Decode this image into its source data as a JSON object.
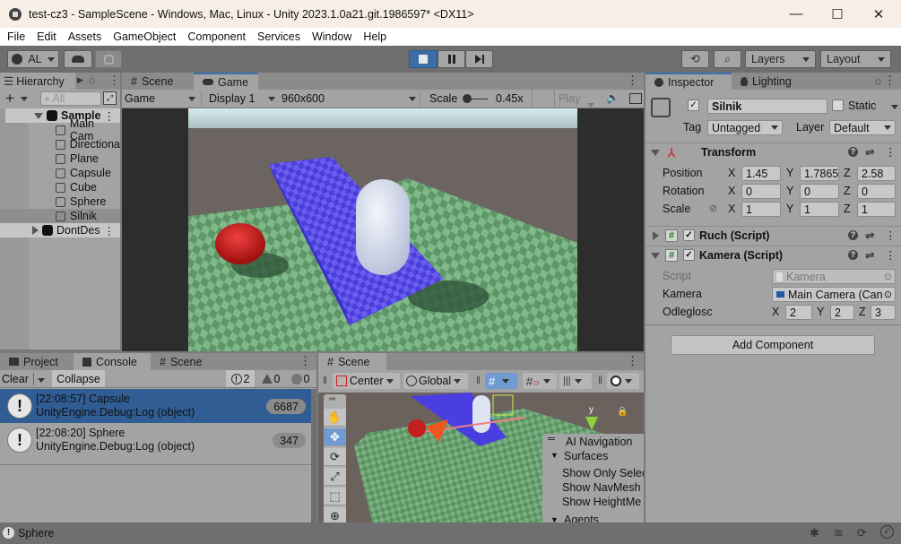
{
  "window": {
    "title": "test-cz3 - SampleScene - Windows, Mac, Linux - Unity 2023.1.0a21.git.1986597* <DX11>",
    "controls": {
      "minimize": "—",
      "maximize": "☐",
      "close": "✕"
    }
  },
  "menu": [
    "File",
    "Edit",
    "Assets",
    "GameObject",
    "Component",
    "Services",
    "Window",
    "Help"
  ],
  "toolbar": {
    "account": "AL",
    "cloud_icon": "cloud-icon",
    "collab_icon": "plastic-icon",
    "play_state": "playing",
    "accent": "#3a6ea5",
    "layers": "Layers",
    "layout": "Layout"
  },
  "hierarchy": {
    "tab": "Hierarchy",
    "search_placeholder": "All",
    "items": [
      {
        "label": "Sample",
        "type": "scene",
        "expanded": true
      },
      {
        "label": "Main Cam",
        "type": "object"
      },
      {
        "label": "Directiona",
        "type": "object"
      },
      {
        "label": "Plane",
        "type": "object"
      },
      {
        "label": "Capsule",
        "type": "object"
      },
      {
        "label": "Cube",
        "type": "object"
      },
      {
        "label": "Sphere",
        "type": "object"
      },
      {
        "label": "Silnik",
        "type": "object",
        "selected": true
      },
      {
        "label": "DontDes",
        "type": "scene",
        "expanded": false
      }
    ]
  },
  "game": {
    "tabs": [
      "Scene",
      "Game"
    ],
    "active_tab": "Game",
    "mode": "Game",
    "display": "Display 1",
    "resolution": "960x600",
    "scale_label": "Scale",
    "scale_value": "0.45x",
    "play_mode": "Play i"
  },
  "inspector": {
    "tabs": [
      "Inspector",
      "Lighting"
    ],
    "object_name": "Silnik",
    "active": true,
    "static_label": "Static",
    "tag_label": "Tag",
    "tag": "Untagged",
    "layer_label": "Layer",
    "layer": "Default",
    "transform": {
      "title": "Transform",
      "rows": [
        {
          "label": "Position",
          "x": "1.45",
          "y": "1.7865",
          "z": "2.58"
        },
        {
          "label": "Rotation",
          "x": "0",
          "y": "0",
          "z": "0"
        },
        {
          "label": "Scale",
          "x": "1",
          "y": "1",
          "z": "1"
        }
      ]
    },
    "components": [
      {
        "title": "Ruch (Script)",
        "expanded": false,
        "enabled": true
      },
      {
        "title": "Kamera (Script)",
        "expanded": true,
        "enabled": true
      }
    ],
    "kamera": {
      "script_label": "Script",
      "script_value": "Kamera",
      "kamera_label": "Kamera",
      "kamera_value": "Main Camera (Can",
      "odl_label": "Odleglosc",
      "x": "2",
      "y": "2",
      "z": "3"
    },
    "add_component": "Add Component"
  },
  "console": {
    "tabs": [
      "Project",
      "Console",
      "Scene"
    ],
    "active_tab": "Console",
    "clear": "Clear",
    "collapse": "Collapse",
    "counts": {
      "info": "2",
      "warn": "0",
      "error": "0"
    },
    "entries": [
      {
        "line1": "[22:08:57] Capsule",
        "line2": "UnityEngine.Debug:Log (object)",
        "count": "6687",
        "selected": true
      },
      {
        "line1": "[22:08:20] Sphere",
        "line2": "UnityEngine.Debug:Log (object)",
        "count": "347",
        "selected": false
      }
    ]
  },
  "scene": {
    "tab": "Scene",
    "pivot": "Center",
    "space": "Global",
    "tools": [
      "hand-icon",
      "move-icon",
      "rotate-icon",
      "scale-icon",
      "rect-icon",
      "transform-icon"
    ],
    "overlay": {
      "title": "AI Navigation",
      "section1": "Surfaces",
      "items": [
        "Show Only Selec",
        "Show NavMesh",
        "Show HeightMe"
      ],
      "section2": "Agents"
    },
    "gizmo_axis": "y"
  },
  "status": {
    "message": "Sphere"
  }
}
